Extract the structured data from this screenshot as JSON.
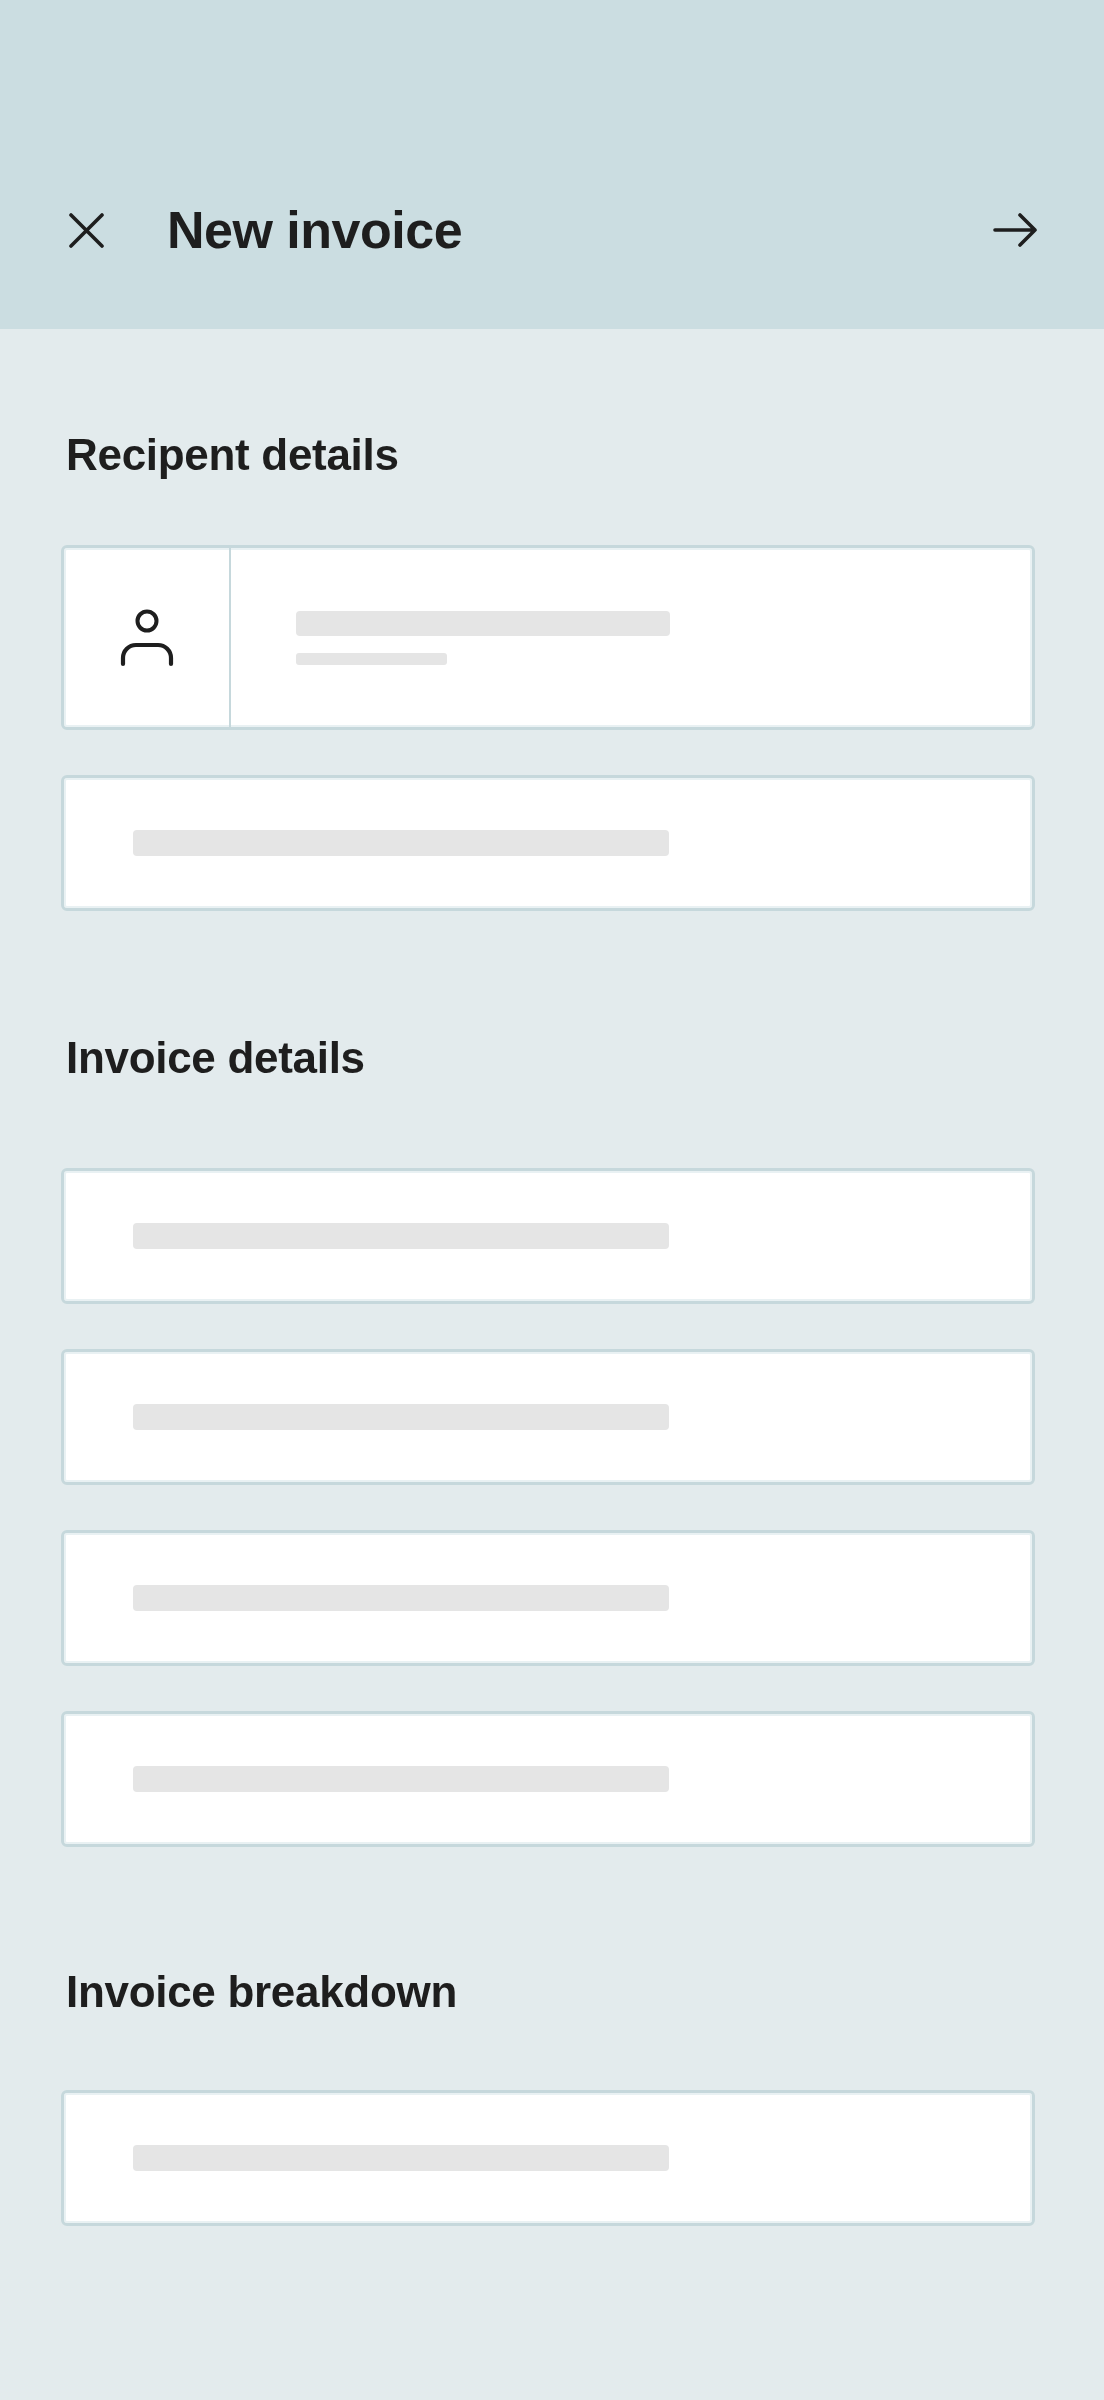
{
  "header": {
    "title": "New invoice"
  },
  "sections": [
    {
      "heading": "Recipent details",
      "fields": [
        {
          "kind": "contact"
        },
        {
          "kind": "line"
        }
      ]
    },
    {
      "heading": "Invoice details",
      "fields": [
        {
          "kind": "line"
        },
        {
          "kind": "line"
        },
        {
          "kind": "line"
        },
        {
          "kind": "line"
        }
      ]
    },
    {
      "heading": "Invoice breakdown",
      "fields": [
        {
          "kind": "line"
        }
      ]
    }
  ]
}
